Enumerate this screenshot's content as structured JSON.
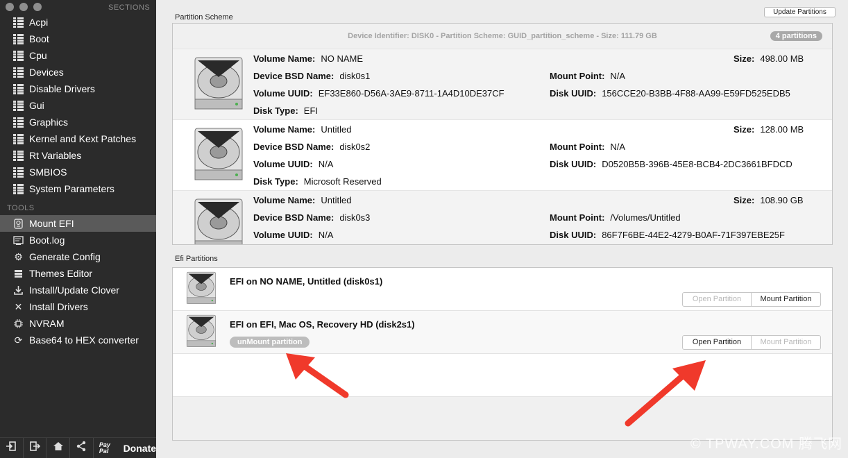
{
  "sidebar": {
    "sections_label": "SECTIONS",
    "tools_label": "TOOLS",
    "sections": [
      {
        "label": "Acpi"
      },
      {
        "label": "Boot"
      },
      {
        "label": "Cpu"
      },
      {
        "label": "Devices"
      },
      {
        "label": "Disable Drivers"
      },
      {
        "label": "Gui"
      },
      {
        "label": "Graphics"
      },
      {
        "label": "Kernel and Kext Patches"
      },
      {
        "label": "Rt Variables"
      },
      {
        "label": "SMBIOS"
      },
      {
        "label": "System Parameters"
      }
    ],
    "tools": [
      {
        "label": "Mount EFI",
        "icon": "disk-icon",
        "active": true
      },
      {
        "label": "Boot.log",
        "icon": "log-icon"
      },
      {
        "label": "Generate Config",
        "icon": "gear-icon"
      },
      {
        "label": "Themes Editor",
        "icon": "stack-icon"
      },
      {
        "label": "Install/Update Clover",
        "icon": "download-icon"
      },
      {
        "label": "Install Drivers",
        "icon": "wrench-icon"
      },
      {
        "label": "NVRAM",
        "icon": "chip-icon"
      },
      {
        "label": "Base64 to HEX converter",
        "icon": "convert-icon"
      }
    ],
    "bottom": {
      "donate": "Donate",
      "paypal": "Pay Pal"
    }
  },
  "main": {
    "update_button": "Update Partitions",
    "partition_scheme_label": "Partition Scheme",
    "device_header": "Device Identifier: DISK0 - Partition Scheme: GUID_partition_scheme - Size: 111.79 GB",
    "partitions_badge": "4 partitions",
    "labels": {
      "volume_name": "Volume Name:",
      "bsd_name": "Device BSD Name:",
      "volume_uuid": "Volume UUID:",
      "disk_type": "Disk Type:",
      "size": "Size:",
      "mount_point": "Mount Point:",
      "disk_uuid": "Disk UUID:"
    },
    "partitions": [
      {
        "volume_name": "NO NAME",
        "bsd_name": "disk0s1",
        "volume_uuid": "EF33E860-D56A-3AE9-8711-1A4D10DE37CF",
        "disk_type": "EFI",
        "size": "498.00 MB",
        "mount_point": "N/A",
        "disk_uuid": "156CCE20-B3BB-4F88-AA99-E59FD525EDB5"
      },
      {
        "volume_name": "Untitled",
        "bsd_name": "disk0s2",
        "volume_uuid": "N/A",
        "disk_type": "Microsoft Reserved",
        "size": "128.00 MB",
        "mount_point": "N/A",
        "disk_uuid": "D0520B5B-396B-45E8-BCB4-2DC3661BFDCD"
      },
      {
        "volume_name": "Untitled",
        "bsd_name": "disk0s3",
        "volume_uuid": "N/A",
        "disk_type": "",
        "size": "108.90 GB",
        "mount_point": "/Volumes/Untitled",
        "disk_uuid": "86F7F6BE-44E2-4279-B0AF-71F397EBE25F"
      }
    ],
    "efi_label": "Efi Partitions",
    "efi": [
      {
        "title": "EFI on NO NAME, Untitled (disk0s1)",
        "open": "Open Partition",
        "mount": "Mount Partition",
        "unmount": ""
      },
      {
        "title": "EFI on EFI, Mac OS, Recovery HD (disk2s1)",
        "open": "Open Partition",
        "mount": "Mount Partition",
        "unmount": "unMount partition"
      }
    ]
  },
  "watermark": "© TPWAY.COM 腾飞网"
}
